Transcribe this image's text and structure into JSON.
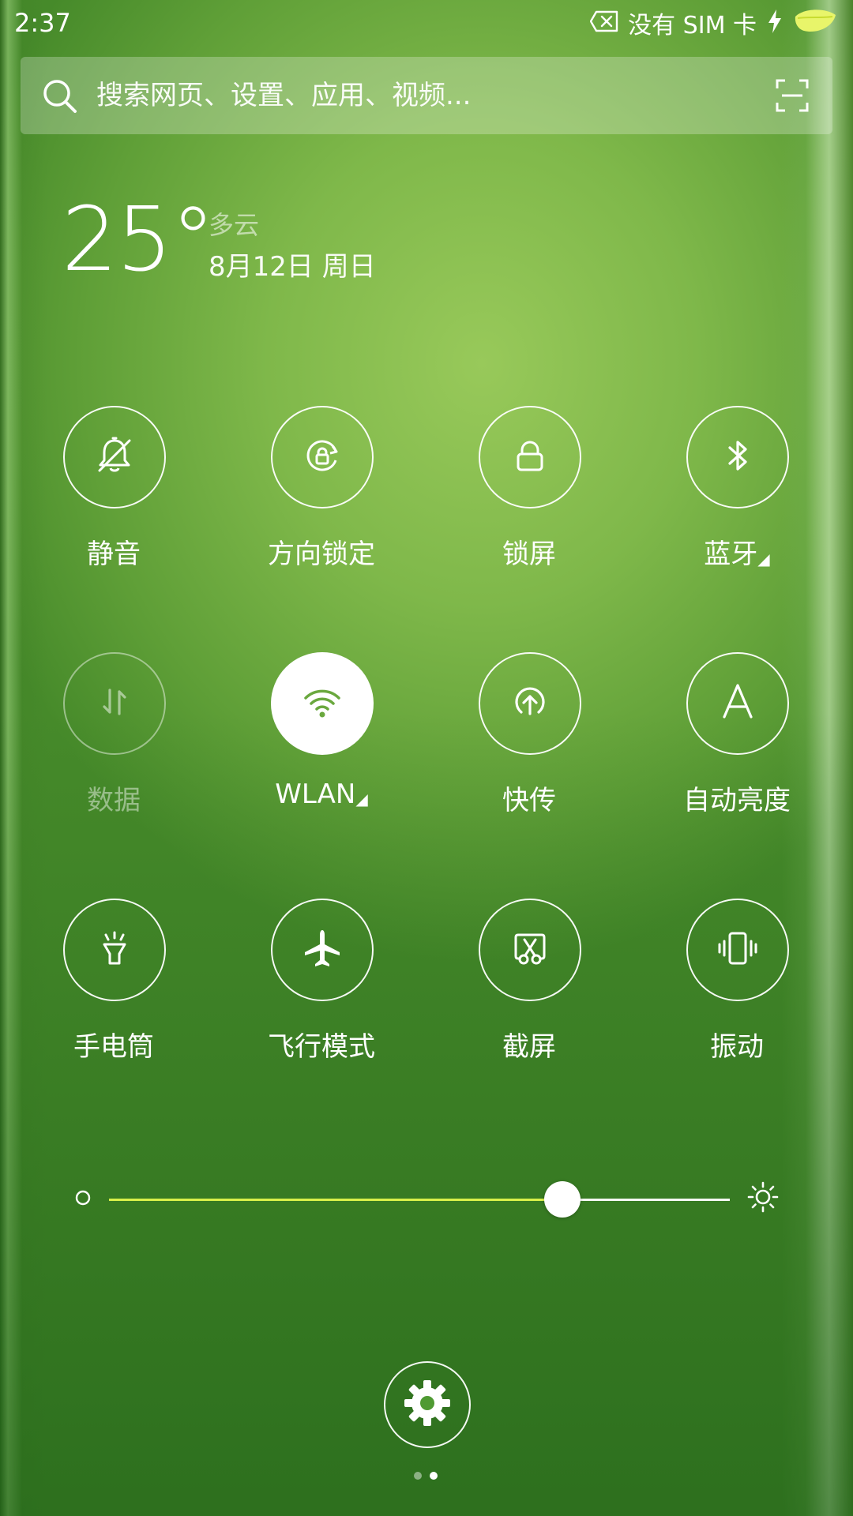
{
  "status_bar": {
    "time": "2:37",
    "sim_text": "没有 SIM 卡",
    "icons": [
      "no-sim-icon",
      "charging-bolt-icon",
      "battery-leaf-icon"
    ]
  },
  "search": {
    "placeholder": "搜索网页、设置、应用、视频...",
    "icons": [
      "search-icon",
      "scan-icon"
    ]
  },
  "weather": {
    "temperature": "25°",
    "condition": "多云",
    "date": "8月12日 周日"
  },
  "toggles": [
    {
      "label": "静音",
      "icon": "bell-off-icon",
      "state": "off"
    },
    {
      "label": "方向锁定",
      "icon": "rotation-lock-icon",
      "state": "off"
    },
    {
      "label": "锁屏",
      "icon": "lock-icon",
      "state": "off"
    },
    {
      "label": "蓝牙",
      "icon": "bluetooth-icon",
      "state": "off",
      "has_submenu": true
    },
    {
      "label": "数据",
      "icon": "mobile-data-icon",
      "state": "disabled"
    },
    {
      "label": "WLAN",
      "icon": "wifi-icon",
      "state": "on",
      "has_submenu": true
    },
    {
      "label": "快传",
      "icon": "quick-transfer-icon",
      "state": "off"
    },
    {
      "label": "自动亮度",
      "icon": "auto-brightness-icon",
      "state": "off"
    },
    {
      "label": "手电筒",
      "icon": "flashlight-icon",
      "state": "off"
    },
    {
      "label": "飞行模式",
      "icon": "airplane-icon",
      "state": "off"
    },
    {
      "label": "截屏",
      "icon": "screenshot-icon",
      "state": "off"
    },
    {
      "label": "振动",
      "icon": "vibrate-icon",
      "state": "off"
    }
  ],
  "submenu_marker": "◢",
  "brightness": {
    "level": 0.73,
    "icons": [
      "brightness-low-icon",
      "brightness-high-icon"
    ]
  },
  "settings": {
    "icon": "gear-icon"
  },
  "pager": {
    "count": 2,
    "active_index": 1
  },
  "colors": {
    "accent": "#d9f04a",
    "background": "#6aa83e",
    "foreground": "#ffffff"
  }
}
